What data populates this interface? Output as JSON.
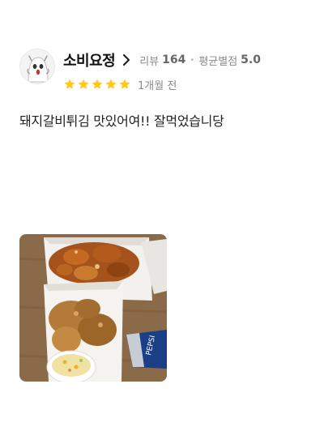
{
  "reviewer": {
    "nickname": "소비요정",
    "review_label": "리뷰",
    "review_count": "164",
    "avg_label": "평균별점",
    "avg_rating": "5.0"
  },
  "rating": {
    "stars": 5,
    "max": 5,
    "star_color": "#FFC81E",
    "time_ago": "1개월 전"
  },
  "review": {
    "text": "돼지갈비튀김 맛있어여!! 잘먹었습니당"
  },
  "icons": {
    "chevron": "chevron-right-icon",
    "star": "star-icon",
    "avatar": "ghost-avatar"
  }
}
